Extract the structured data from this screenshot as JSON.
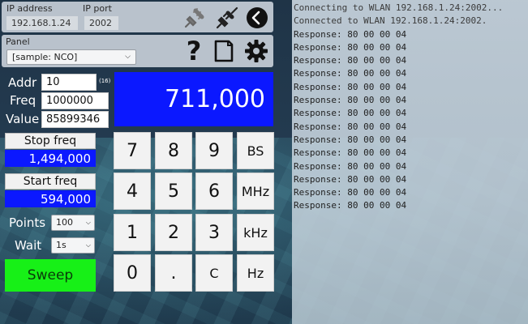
{
  "connection": {
    "ip_label": "IP address",
    "ip_value": "192.168.1.24",
    "port_label": "IP port",
    "port_value": "2002"
  },
  "toolbar": {
    "icons": [
      "disconnect-plug-icon",
      "connect-plug-icon",
      "back-icon"
    ]
  },
  "panel": {
    "label": "Panel",
    "selected": "[sample: NCO]",
    "icons": [
      "help-icon",
      "document-icon",
      "settings-icon"
    ]
  },
  "fields": {
    "addr_label": "Addr",
    "addr_value": "10",
    "addr_base": "(16)",
    "freq_label": "Freq",
    "freq_value": "1000000",
    "value_label": "Value",
    "value_value": "85899346"
  },
  "display": {
    "value": "711,000"
  },
  "sweep": {
    "stop_label": "Stop freq",
    "stop_value": "1,494,000",
    "start_label": "Start freq",
    "start_value": "594,000",
    "points_label": "Points",
    "points_value": "100",
    "wait_label": "Wait",
    "wait_value": "1s",
    "button_label": "Sweep"
  },
  "keypad": {
    "keys": [
      "7",
      "8",
      "9",
      "BS",
      "4",
      "5",
      "6",
      "MHz",
      "1",
      "2",
      "3",
      "kHz",
      "0",
      ".",
      "C",
      "Hz"
    ]
  },
  "log": {
    "lines": [
      "Connecting to WLAN 192.168.1.24:2002...",
      "Connected to WLAN 192.168.1.24:2002.",
      "Response: 80 00 00 04",
      "Response: 80 00 00 04",
      "Response: 80 00 00 04",
      "Response: 80 00 00 04",
      "Response: 80 00 00 04",
      "Response: 80 00 00 04",
      "Response: 80 00 00 04",
      "Response: 80 00 00 04",
      "Response: 80 00 00 04",
      "Response: 80 00 00 04",
      "Response: 80 00 00 04",
      "Response: 80 00 00 04",
      "Response: 80 00 00 04",
      "Response: 80 00 00 04"
    ]
  },
  "colors": {
    "accent_blue": "#0b18ff",
    "sweep_green": "#17f017",
    "background": "#243c52"
  }
}
